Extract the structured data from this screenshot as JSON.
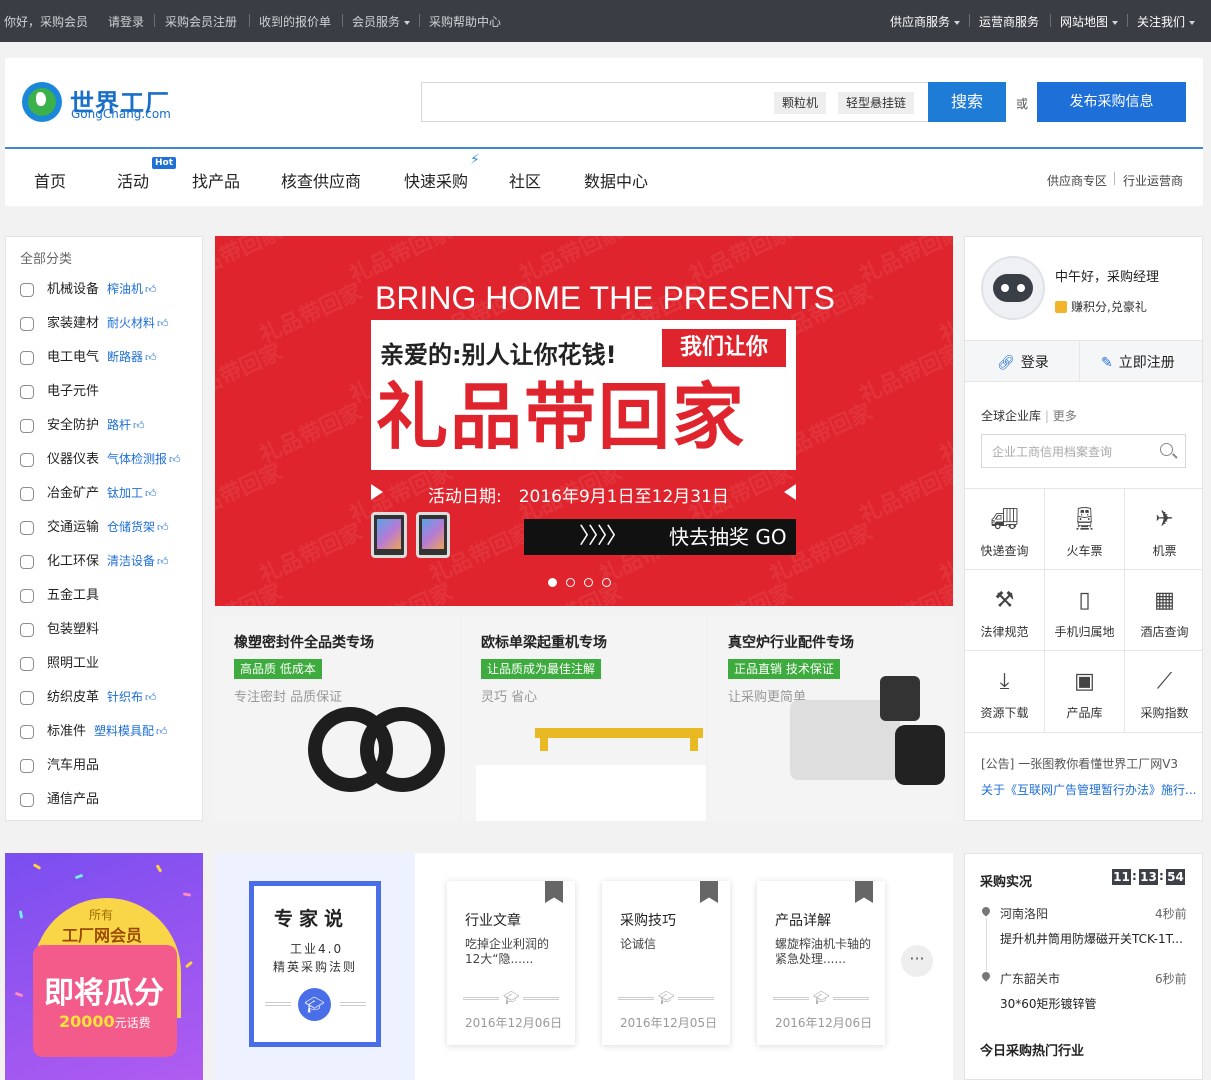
{
  "topbar": {
    "greeting": "你好，采购会员",
    "login": "请登录",
    "register": "采购会员注册",
    "quotes": "收到的报价单",
    "member_service": "会员服务",
    "help": "采购帮助中心",
    "supplier_service": "供应商服务",
    "operator_service": "运营商服务",
    "sitemap": "网站地图",
    "follow": "关注我们"
  },
  "header": {
    "logo_cn": "世界工厂",
    "logo_en": "GongChang.com",
    "search_tags": [
      "颗粒机",
      "轻型悬挂链"
    ],
    "search_button": "搜索",
    "or": "或",
    "post_button": "发布采购信息"
  },
  "nav": {
    "items": [
      "首页",
      "活动",
      "找产品",
      "核查供应商",
      "快速采购",
      "社区",
      "数据中心"
    ],
    "hot_badge": "Hot",
    "right_links": [
      "供应商专区",
      "行业运营商"
    ]
  },
  "categories": {
    "title": "全部分类",
    "items": [
      {
        "name": "机械设备",
        "hot": "榨油机"
      },
      {
        "name": "家装建材",
        "hot": "耐火材料"
      },
      {
        "name": "电工电气",
        "hot": "断路器"
      },
      {
        "name": "电子元件",
        "hot": ""
      },
      {
        "name": "安全防护",
        "hot": "路杆"
      },
      {
        "name": "仪器仪表",
        "hot": "气体检测报"
      },
      {
        "name": "冶金矿产",
        "hot": "钛加工"
      },
      {
        "name": "交通运输",
        "hot": "仓储货架"
      },
      {
        "name": "化工环保",
        "hot": "清洁设备"
      },
      {
        "name": "五金工具",
        "hot": ""
      },
      {
        "name": "包装塑料",
        "hot": ""
      },
      {
        "name": "照明工业",
        "hot": ""
      },
      {
        "name": "纺织皮革",
        "hot": "针织布"
      },
      {
        "name": "标准件",
        "hot": "塑料模具配"
      },
      {
        "name": "汽车用品",
        "hot": ""
      },
      {
        "name": "通信产品",
        "hot": ""
      }
    ]
  },
  "banner": {
    "en_title": "BRING HOME THE PRESENTS",
    "line1": "亲爱的:别人让你花钱!",
    "red_tag": "我们让你",
    "big": "礼品带回家",
    "date": "活动日期:　2016年9月1日至12月31日",
    "go": "快去抽奖 GO",
    "watermark": "礼品带回家",
    "slide_count": 4,
    "active_slide": 1
  },
  "promos": [
    {
      "title": "橡塑密封件全品类专场",
      "tag": "高品质 低成本",
      "sub": "专注密封 品质保证"
    },
    {
      "title": "欧标单梁起重机专场",
      "tag": "让品质成为最佳注解",
      "sub": "灵巧 省心"
    },
    {
      "title": "真空炉行业配件专场",
      "tag": "正品直销 技术保证",
      "sub": "让采购更简单"
    }
  ],
  "user": {
    "greeting": "中午好，采购经理",
    "points": "赚积分,兑豪礼",
    "login": "登录",
    "register": "立即注册",
    "lib_title": "全球企业库",
    "lib_more": "更多",
    "lib_placeholder": "企业工商信用档案查询",
    "tools": [
      {
        "label": "快递查询",
        "icon": "truck-icon"
      },
      {
        "label": "火车票",
        "icon": "train-icon"
      },
      {
        "label": "机票",
        "icon": "plane-icon"
      },
      {
        "label": "法律规范",
        "icon": "gavel-icon"
      },
      {
        "label": "手机归属地",
        "icon": "phone-icon"
      },
      {
        "label": "酒店查询",
        "icon": "hotel-icon"
      },
      {
        "label": "资源下载",
        "icon": "download-icon"
      },
      {
        "label": "产品库",
        "icon": "box-icon"
      },
      {
        "label": "采购指数",
        "icon": "chart-icon"
      }
    ],
    "notice_tag": "[公告]",
    "notice1": "一张图教你看懂世界工厂网V3",
    "notice2": "关于《互联网广告管理暂行办法》施行..."
  },
  "member_promo": {
    "line1": "所有",
    "line2": "工厂网会员",
    "line3": "即将瓜分",
    "amount": "20000",
    "unit": "元话费"
  },
  "expert": {
    "title": "专家说",
    "sub1": "工业4.0",
    "sub2": "精英采购法则",
    "articles": [
      {
        "title": "行业文章",
        "text": "吃掉企业利润的12大“隐......",
        "date": "2016年12月06日"
      },
      {
        "title": "采购技巧",
        "text": "论诚信",
        "date": "2016年12月05日"
      },
      {
        "title": "产品详解",
        "text": "螺旋榨油机卡轴的紧急处理......",
        "date": "2016年12月06日"
      }
    ],
    "more": "···"
  },
  "purchase": {
    "title": "采购实况",
    "clock": [
      "11",
      "13",
      "54"
    ],
    "items": [
      {
        "loc": "河南洛阳",
        "time": "4秒前",
        "desc": "提升机井筒用防爆磁开关TCK-1T..."
      },
      {
        "loc": "广东韶关市",
        "time": "6秒前",
        "desc": "30*60矩形镀锌管"
      }
    ],
    "hot_title": "今日采购热门行业"
  }
}
